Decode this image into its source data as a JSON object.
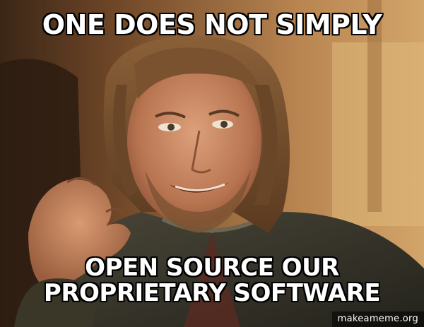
{
  "meme": {
    "top_text": "ONE DOES NOT SIMPLY",
    "bottom_text_line1": "OPEN SOURCE OUR",
    "bottom_text_line2": "PROPRIETARY SOFTWARE",
    "watermark": "makeameme.org"
  },
  "colors": {
    "caption_fill": "#ffffff",
    "caption_stroke": "#000000",
    "background_warm": "#c08a4e",
    "background_dark": "#3a2616",
    "skin": "#c8875c",
    "hair": "#7a5230",
    "coat": "#3c3a30"
  }
}
